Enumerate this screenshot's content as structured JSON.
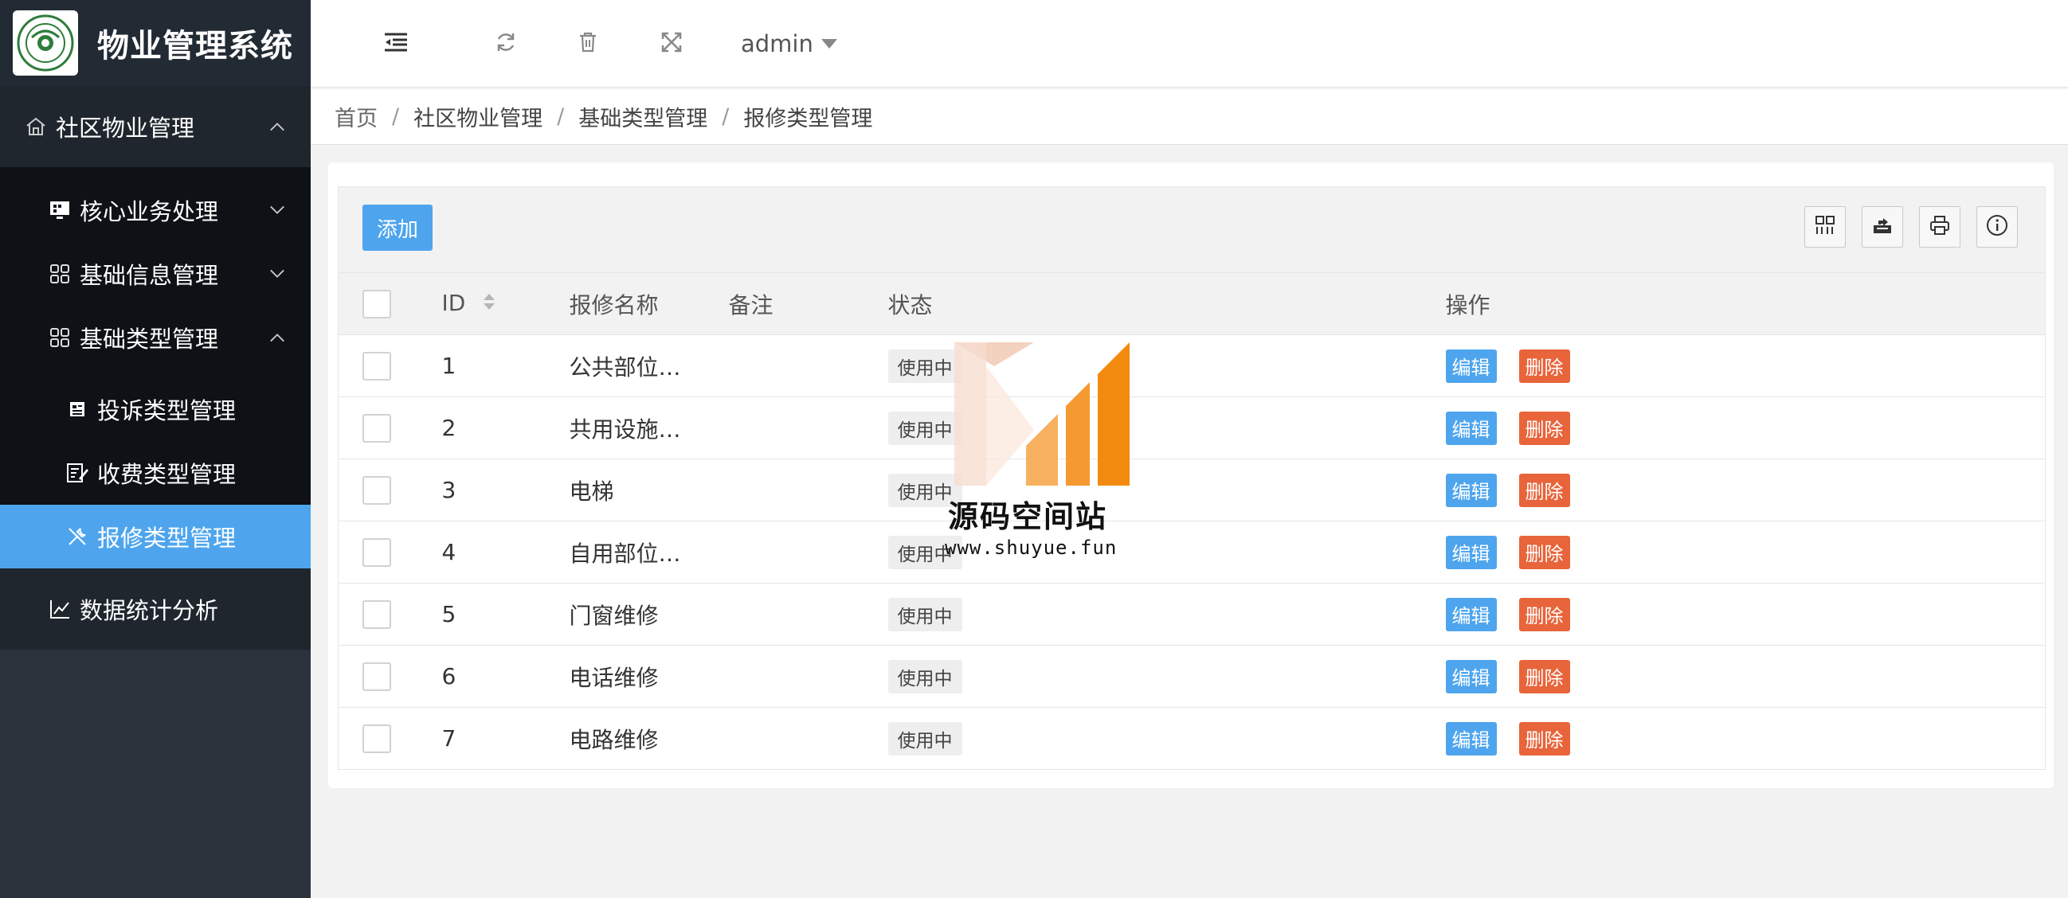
{
  "app": {
    "title": "物业管理系统",
    "logo_alt": "university seal logo"
  },
  "sidebar": {
    "top": {
      "label": "社区物业管理",
      "icon": "house-icon"
    },
    "items": [
      {
        "label": "核心业务处理",
        "icon": "monitor-icon",
        "expanded": false
      },
      {
        "label": "基础信息管理",
        "icon": "grid-icon",
        "expanded": false
      },
      {
        "label": "基础类型管理",
        "icon": "grid-icon",
        "expanded": true
      }
    ],
    "subitems": [
      {
        "label": "投诉类型管理",
        "icon": "document-icon"
      },
      {
        "label": "收费类型管理",
        "icon": "edit-doc-icon"
      },
      {
        "label": "报修类型管理",
        "icon": "tools-icon",
        "active": true
      }
    ],
    "bottom": {
      "label": "数据统计分析",
      "icon": "line-chart-icon"
    }
  },
  "header": {
    "user": "admin"
  },
  "breadcrumb": [
    "首页",
    "社区物业管理",
    "基础类型管理",
    "报修类型管理"
  ],
  "toolbar": {
    "add_label": "添加"
  },
  "table": {
    "columns": [
      "ID",
      "报修名称",
      "备注",
      "状态",
      "操作"
    ],
    "rows": [
      {
        "id": "1",
        "name": "公共部位…",
        "note": "",
        "status": "使用中"
      },
      {
        "id": "2",
        "name": "共用设施…",
        "note": "",
        "status": "使用中"
      },
      {
        "id": "3",
        "name": "电梯",
        "note": "",
        "status": "使用中"
      },
      {
        "id": "4",
        "name": "自用部位…",
        "note": "",
        "status": "使用中"
      },
      {
        "id": "5",
        "name": "门窗维修",
        "note": "",
        "status": "使用中"
      },
      {
        "id": "6",
        "name": "电话维修",
        "note": "",
        "status": "使用中"
      },
      {
        "id": "7",
        "name": "电路维修",
        "note": "",
        "status": "使用中"
      }
    ],
    "edit_label": "编辑",
    "delete_label": "删除"
  },
  "watermark": {
    "title": "源码空间站",
    "url": "www.shuyue.fun"
  },
  "colors": {
    "sidebar_bg": "#2b323c",
    "sidebar_active": "#4ea5ee",
    "primary": "#4ea5ee",
    "danger": "#e8643a"
  }
}
